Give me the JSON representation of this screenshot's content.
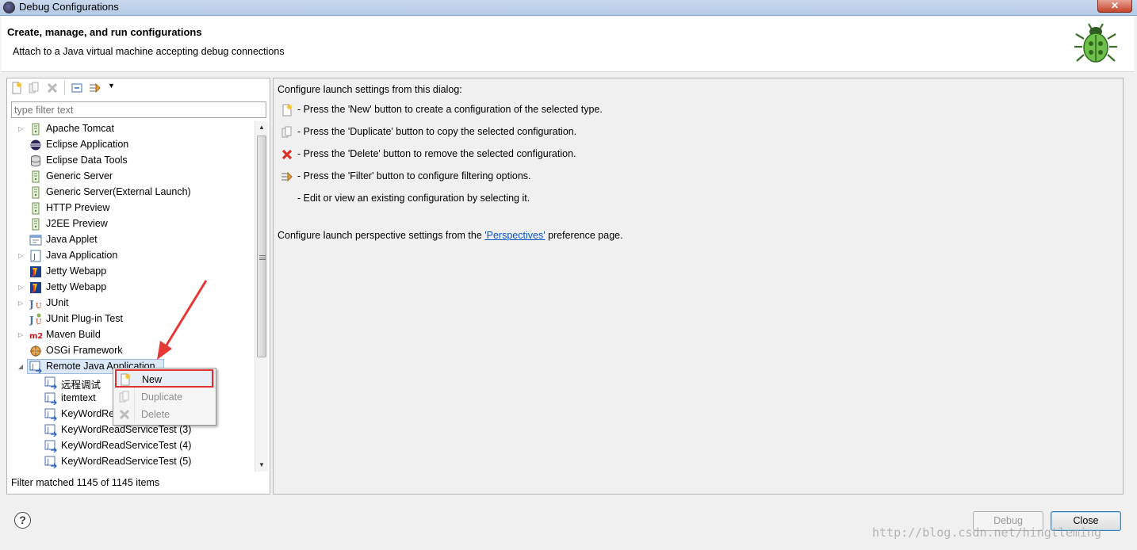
{
  "window": {
    "title": "Debug Configurations"
  },
  "header": {
    "title": "Create, manage, and run configurations",
    "subtitle": "Attach to a Java virtual machine accepting debug connections"
  },
  "left": {
    "filter_placeholder": "type filter text",
    "tree": [
      {
        "label": "Apache Tomcat",
        "icon": "server-icon",
        "arrow": "right",
        "indent": 0
      },
      {
        "label": "Eclipse Application",
        "icon": "eclipse-icon",
        "arrow": "",
        "indent": 0
      },
      {
        "label": "Eclipse Data Tools",
        "icon": "database-icon",
        "arrow": "",
        "indent": 0
      },
      {
        "label": "Generic Server",
        "icon": "server-icon",
        "arrow": "",
        "indent": 0
      },
      {
        "label": "Generic Server(External Launch)",
        "icon": "server-icon",
        "arrow": "",
        "indent": 0
      },
      {
        "label": "HTTP Preview",
        "icon": "server-icon",
        "arrow": "",
        "indent": 0
      },
      {
        "label": "J2EE Preview",
        "icon": "server-icon",
        "arrow": "",
        "indent": 0
      },
      {
        "label": "Java Applet",
        "icon": "applet-icon",
        "arrow": "",
        "indent": 0
      },
      {
        "label": "Java Application",
        "icon": "java-app-icon",
        "arrow": "right",
        "indent": 0
      },
      {
        "label": "Jetty Webapp",
        "icon": "jetty-icon",
        "arrow": "",
        "indent": 0
      },
      {
        "label": "Jetty Webapp",
        "icon": "jetty-icon",
        "arrow": "right",
        "indent": 0
      },
      {
        "label": "JUnit",
        "icon": "junit-icon",
        "arrow": "right",
        "indent": 0
      },
      {
        "label": "JUnit Plug-in Test",
        "icon": "junit-plugin-icon",
        "arrow": "",
        "indent": 0
      },
      {
        "label": "Maven Build",
        "icon": "maven-icon",
        "arrow": "right",
        "indent": 0
      },
      {
        "label": "OSGi Framework",
        "icon": "osgi-icon",
        "arrow": "",
        "indent": 0
      },
      {
        "label": "Remote Java Application",
        "icon": "remote-java-icon",
        "arrow": "down",
        "indent": 0,
        "selected": true
      },
      {
        "label": "远程调试",
        "icon": "remote-java-icon",
        "arrow": "",
        "indent": 1
      },
      {
        "label": "itemtext",
        "icon": "remote-java-icon",
        "arrow": "",
        "indent": 1
      },
      {
        "label": "KeyWordRe",
        "icon": "remote-java-icon",
        "arrow": "",
        "indent": 1
      },
      {
        "label": "KeyWordReadServiceTest (3)",
        "icon": "remote-java-icon",
        "arrow": "",
        "indent": 1
      },
      {
        "label": "KeyWordReadServiceTest (4)",
        "icon": "remote-java-icon",
        "arrow": "",
        "indent": 1
      },
      {
        "label": "KeyWordReadServiceTest (5)",
        "icon": "remote-java-icon",
        "arrow": "",
        "indent": 1
      }
    ],
    "status": "Filter matched 1145 of 1145 items"
  },
  "context_menu": {
    "items": [
      {
        "label": "New",
        "icon": "new-config-icon",
        "enabled": true
      },
      {
        "label": "Duplicate",
        "icon": "duplicate-icon",
        "enabled": false
      },
      {
        "label": "Delete",
        "icon": "delete-icon",
        "enabled": false
      }
    ]
  },
  "right": {
    "intro": "Configure launch settings from this dialog:",
    "lines": [
      {
        "icon": "new-config-icon",
        "text": "- Press the 'New' button to create a configuration of the selected type."
      },
      {
        "icon": "duplicate-icon",
        "text": "- Press the 'Duplicate' button to copy the selected configuration."
      },
      {
        "icon": "delete-icon",
        "text": "- Press the 'Delete' button to remove the selected configuration."
      },
      {
        "icon": "filter-icon",
        "text": "- Press the 'Filter' button to configure filtering options."
      },
      {
        "icon": "",
        "text": "- Edit or view an existing configuration by selecting it."
      }
    ],
    "perspectives_before": "Configure launch perspective settings from the ",
    "perspectives_link": "'Perspectives'",
    "perspectives_after": " preference page."
  },
  "buttons": {
    "debug": "Debug",
    "close": "Close"
  },
  "watermark": "http://blog.csdn.net/hingtleming"
}
